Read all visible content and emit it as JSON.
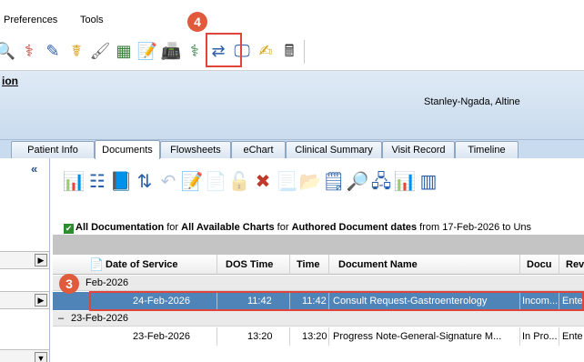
{
  "menu": {
    "preferences": "Preferences",
    "tools": "Tools"
  },
  "header": {
    "partial_title": "ion",
    "patient_name": "Stanley-Ngada, Altine"
  },
  "tabs": [
    {
      "label": "Patient Info",
      "active": false
    },
    {
      "label": "Documents",
      "active": true
    },
    {
      "label": "Flowsheets",
      "active": false
    },
    {
      "label": "eChart",
      "active": false
    },
    {
      "label": "Clinical Summary",
      "active": false
    },
    {
      "label": "Visit Record",
      "active": false
    },
    {
      "label": "Timeline",
      "active": false
    }
  ],
  "left_pane": {
    "collapse_glyph": "«"
  },
  "filter": {
    "part1": "All Documentation",
    "part2": " for ",
    "part3": "All Available Charts",
    "part4": " for ",
    "part5": "Authored Document dates",
    "part6": "  from 17-Feb-2026 to Uns"
  },
  "grid": {
    "columns": [
      "Date of Service",
      "DOS Time",
      "Time",
      "Document Name",
      "Docu",
      "Rev"
    ],
    "groups": [
      {
        "label": "Feb-2026",
        "rows": [
          {
            "date": "24-Feb-2026",
            "dos_time": "11:42",
            "time": "11:42",
            "name": "Consult Request-Gastroenterology",
            "docu": "Incom...",
            "rev": "Ente",
            "selected": true
          }
        ]
      },
      {
        "label": "23-Feb-2026",
        "expander": "–",
        "rows": [
          {
            "date": "23-Feb-2026",
            "dos_time": "13:20",
            "time": "13:20",
            "name": "Progress Note-General-Signature M...",
            "docu": "In Pro...",
            "rev": "Ente",
            "selected": false
          }
        ]
      }
    ]
  },
  "callouts": {
    "step_3": "3",
    "step_4": "4"
  },
  "colors": {
    "selection": "#4f84b8",
    "callout": "#e05a3c",
    "highlight": "#e0443a",
    "header_bg": "#c9dbee"
  }
}
